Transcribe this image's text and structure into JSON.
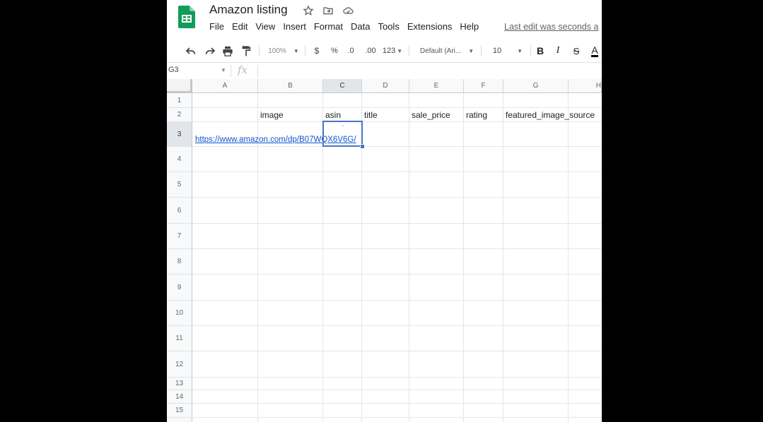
{
  "app": {
    "title": "Amazon listing",
    "icons": [
      "sheets-logo-icon",
      "star-icon",
      "move-folder-icon",
      "cloud-status-icon"
    ]
  },
  "menu": [
    "File",
    "Edit",
    "View",
    "Insert",
    "Format",
    "Data",
    "Tools",
    "Extensions",
    "Help"
  ],
  "last_edit": "Last edit was seconds a",
  "toolbar": {
    "zoom": "100%",
    "currency": "$",
    "percent": "%",
    "dec_decrease": ".0",
    "dec_increase": ".00",
    "more_formats": "123",
    "font": "Default (Ari...",
    "font_size": "10",
    "bold": "B",
    "italic": "I",
    "strike": "S",
    "text_color": "A",
    "icons": [
      "undo-icon",
      "redo-icon",
      "print-icon",
      "paint-format-icon",
      "chevron-down-icon"
    ]
  },
  "formula_bar": {
    "name_box": "G3",
    "fx": "fx",
    "value": ""
  },
  "grid": {
    "columns": [
      "A",
      "B",
      "C",
      "D",
      "E",
      "F",
      "G",
      "H"
    ],
    "rows": [
      "1",
      "2",
      "3",
      "4",
      "5",
      "6",
      "7",
      "8",
      "9",
      "10",
      "11",
      "12",
      "13",
      "14",
      "15"
    ],
    "selected_column": "C",
    "selected_row": "3",
    "row2_headers": [
      "image",
      "asin",
      "title",
      "sale_price",
      "rating",
      "featured_image_source"
    ],
    "a3_link": "https://www.amazon.com/dp/B07WQX6V6G/",
    "c3_value": "'"
  },
  "colors": {
    "sheets_green": "#0F9D58",
    "selection": "#4A73C9",
    "link": "#1155CC"
  }
}
